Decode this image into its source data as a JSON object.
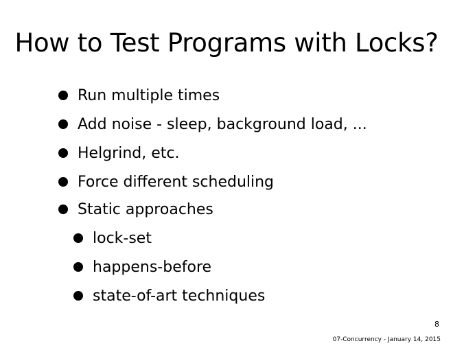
{
  "slide": {
    "title": "How to Test Programs with Locks?",
    "bullets": [
      {
        "text": "Run multiple times",
        "level": 1
      },
      {
        "text": "Add noise - sleep, background load, ...",
        "level": 1
      },
      {
        "text": "Helgrind, etc.",
        "level": 1
      },
      {
        "text": "Force different scheduling",
        "level": 1
      },
      {
        "text": "Static approaches",
        "level": 1
      },
      {
        "text": "lock-set",
        "level": 2
      },
      {
        "text": "happens-before",
        "level": 2
      },
      {
        "text": "state-of-art techniques",
        "level": 2
      }
    ],
    "page_number": "8",
    "footer": "07-Concurrency - January 14, 2015"
  }
}
